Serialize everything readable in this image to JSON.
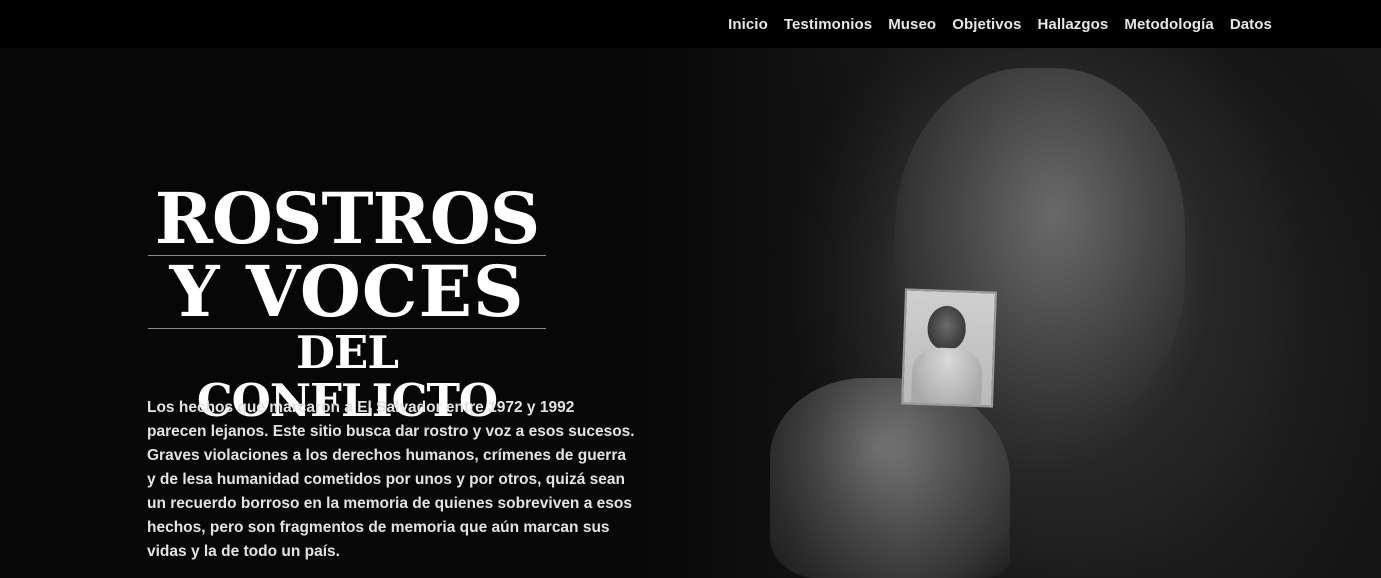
{
  "nav": {
    "items": [
      {
        "label": "Inicio"
      },
      {
        "label": "Testimonios"
      },
      {
        "label": "Museo"
      },
      {
        "label": "Objetivos"
      },
      {
        "label": "Hallazgos"
      },
      {
        "label": "Metodología"
      },
      {
        "label": "Datos"
      }
    ]
  },
  "hero": {
    "title_line1": "ROSTROS",
    "title_line2": "Y VOCES",
    "title_line3": "DEL CONFLICTO",
    "intro": "Los hechos que marcaron a El Salvador entre 1972 y 1992 parecen lejanos. Este sitio busca dar rostro y voz a esos sucesos. Graves violaciones a los derechos humanos, crímenes de guerra y de lesa humanidad cometidos por unos y por otros, quizá sean un recuerdo borroso en la memoria de quienes sobreviven a esos hechos, pero son fragmentos de memoria que aún marcan sus vidas y la de todo un país."
  },
  "colors": {
    "background": "#070707",
    "nav_background": "#000000",
    "nav_text": "#e6e6e6",
    "title_text": "#ffffff",
    "body_text": "#e3e3e3"
  }
}
